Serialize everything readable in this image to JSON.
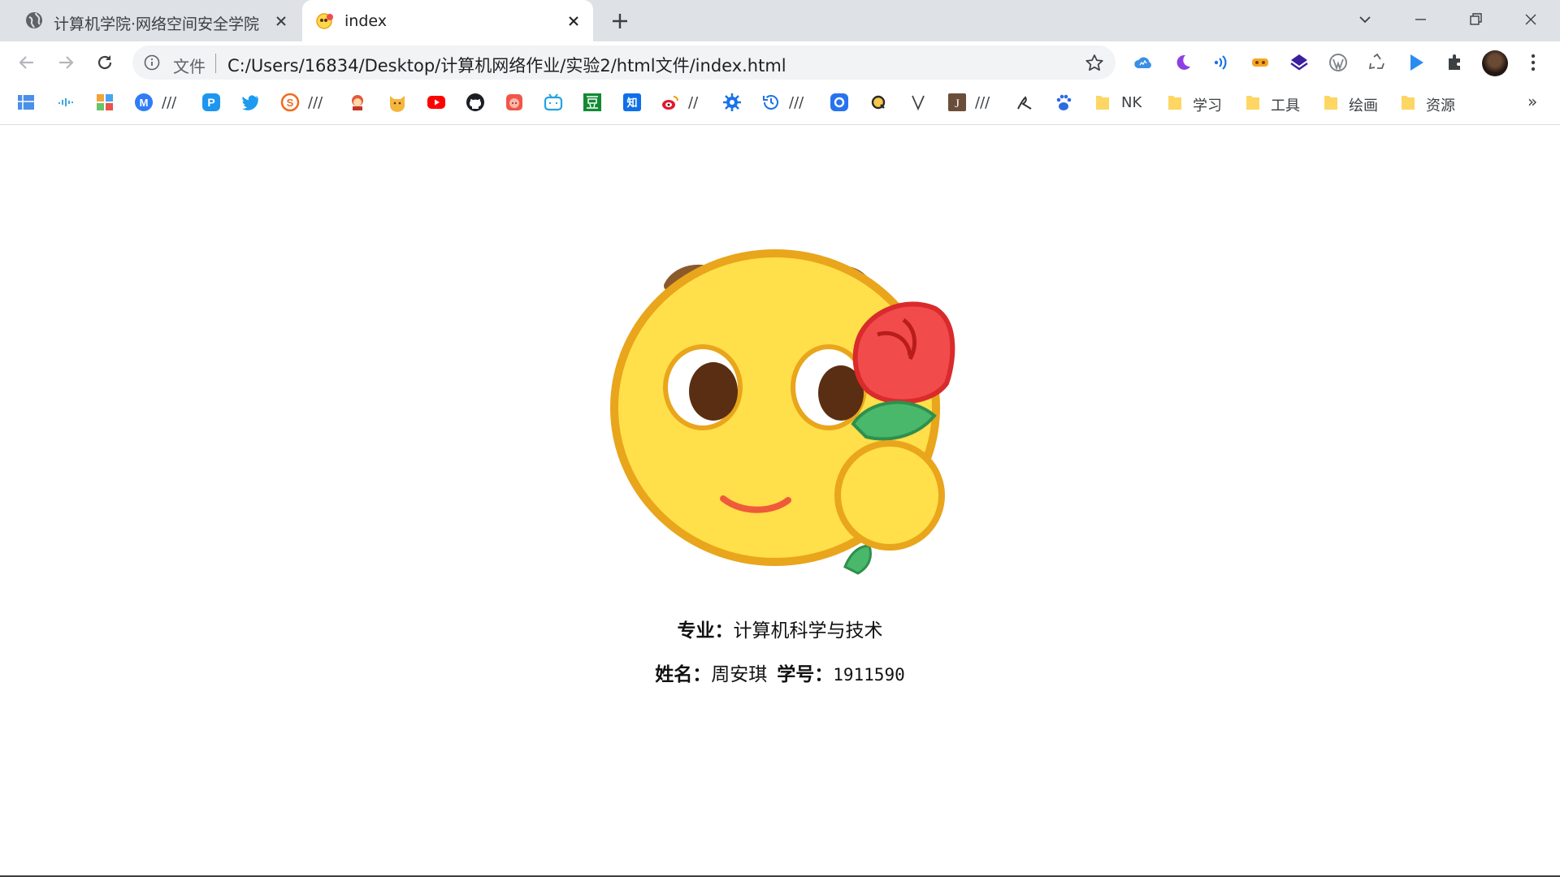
{
  "tabs": [
    {
      "title": "计算机学院·网络空间安全学院",
      "favicon": "globe-icon",
      "active": false
    },
    {
      "title": "index",
      "favicon": "smiley-rose-icon",
      "active": true
    }
  ],
  "window_controls": [
    "tab-search-icon",
    "minimize-icon",
    "restore-icon",
    "close-icon"
  ],
  "address_bar": {
    "scheme_label": "文件",
    "url": "C:/Users/16834/Desktop/计算机网络作业/实验2/html文件/index.html"
  },
  "bookmarks": {
    "sep_texts": [
      "///",
      "///",
      "//",
      "///",
      "///"
    ],
    "folders": [
      "NK",
      "学习",
      "工具",
      "绘画",
      "资源"
    ],
    "overflow": "»"
  },
  "page": {
    "major_label": "专业：",
    "major_value": "计算机科学与技术",
    "name_label": "姓名：",
    "name_value": "周安琪",
    "id_label": "学号：",
    "id_value": "1911590"
  },
  "colors": {
    "tabstrip": "#dee1e6",
    "omnibox": "#f1f3f4",
    "emoji_face": "#ffdf4a",
    "emoji_outline": "#e9a51b",
    "rose": "#f24b4b",
    "leaf": "#49b86b"
  }
}
